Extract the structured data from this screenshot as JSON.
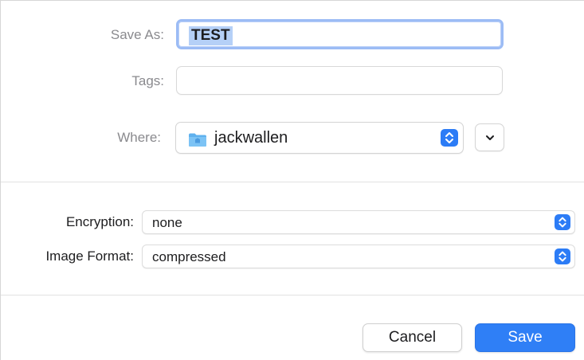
{
  "dialog": {
    "save_as": {
      "label": "Save As:",
      "value": "TEST"
    },
    "tags": {
      "label": "Tags:",
      "value": ""
    },
    "where": {
      "label": "Where:",
      "value": "jackwallen",
      "icon": "folder-icon"
    },
    "encryption": {
      "label": "Encryption:",
      "value": "none"
    },
    "image_format": {
      "label": "Image Format:",
      "value": "compressed"
    },
    "buttons": {
      "cancel": "Cancel",
      "save": "Save"
    }
  },
  "colors": {
    "accent": "#2f7ff6",
    "focus_ring": "#9cbcf5",
    "selection": "#b5d0f7"
  }
}
